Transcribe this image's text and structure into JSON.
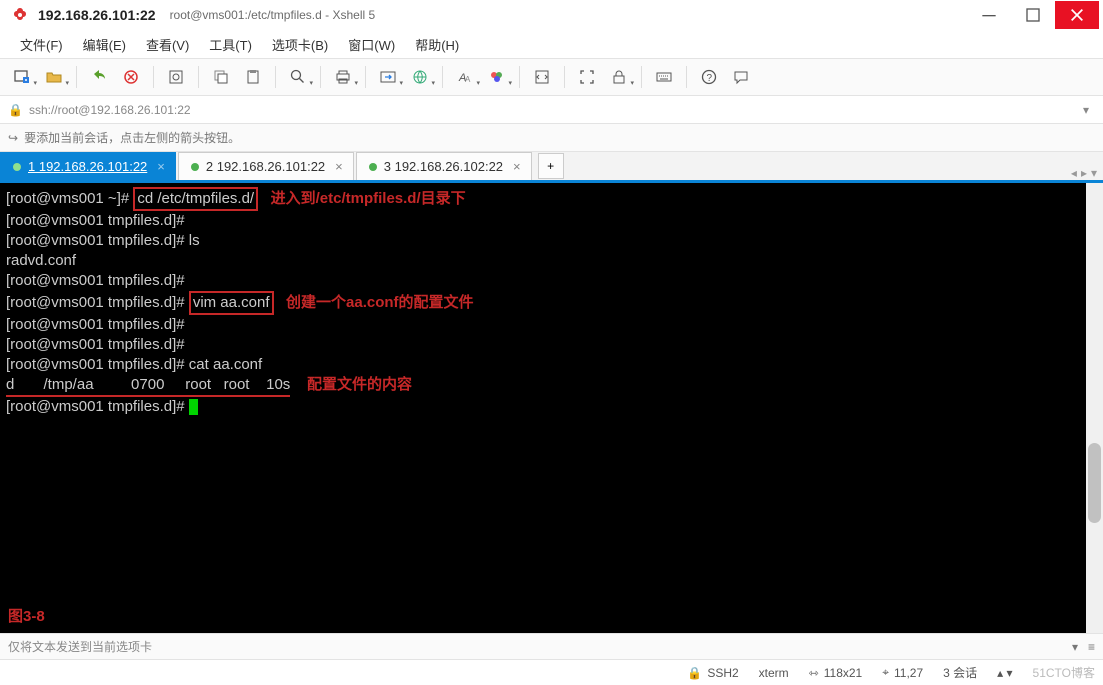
{
  "window": {
    "title_main": "192.168.26.101:22",
    "title_path": "root@vms001:/etc/tmpfiles.d - Xshell 5"
  },
  "menu": {
    "file": "文件(F)",
    "edit": "编辑(E)",
    "view": "查看(V)",
    "tools": "工具(T)",
    "tabs": "选项卡(B)",
    "window": "窗口(W)",
    "help": "帮助(H)"
  },
  "addressbar": {
    "url": "ssh://root@192.168.26.101:22"
  },
  "hint": {
    "text": "要添加当前会话，点击左侧的箭头按钮。"
  },
  "tabs": {
    "items": [
      {
        "label": "1 192.168.26.101:22",
        "active": true
      },
      {
        "label": "2 192.168.26.101:22",
        "active": false
      },
      {
        "label": "3 192.168.26.102:22",
        "active": false
      }
    ]
  },
  "terminal": {
    "prompt_home": "[root@vms001 ~]# ",
    "prompt_dir": "[root@vms001 tmpfiles.d]#",
    "cmd_cd": "cd /etc/tmpfiles.d/",
    "ann_cd": "进入到/etc/tmpfiles.d/目录下",
    "cmd_ls": " ls",
    "out_ls": "radvd.conf",
    "cmd_vim": "vim aa.conf",
    "ann_vim": "创建一个aa.conf的配置文件",
    "cmd_cat": " cat aa.conf",
    "out_cat": "d       /tmp/aa         0700     root   root    10s",
    "ann_content": "配置文件的内容",
    "figure_label": "图3-8"
  },
  "footer": {
    "placeholder": "仅将文本发送到当前选项卡"
  },
  "status": {
    "protocol": "SSH2",
    "term": "xterm",
    "size": "118x21",
    "cursor": "11,27",
    "sessions": "3 会话",
    "watermark": "51CTO博客"
  }
}
